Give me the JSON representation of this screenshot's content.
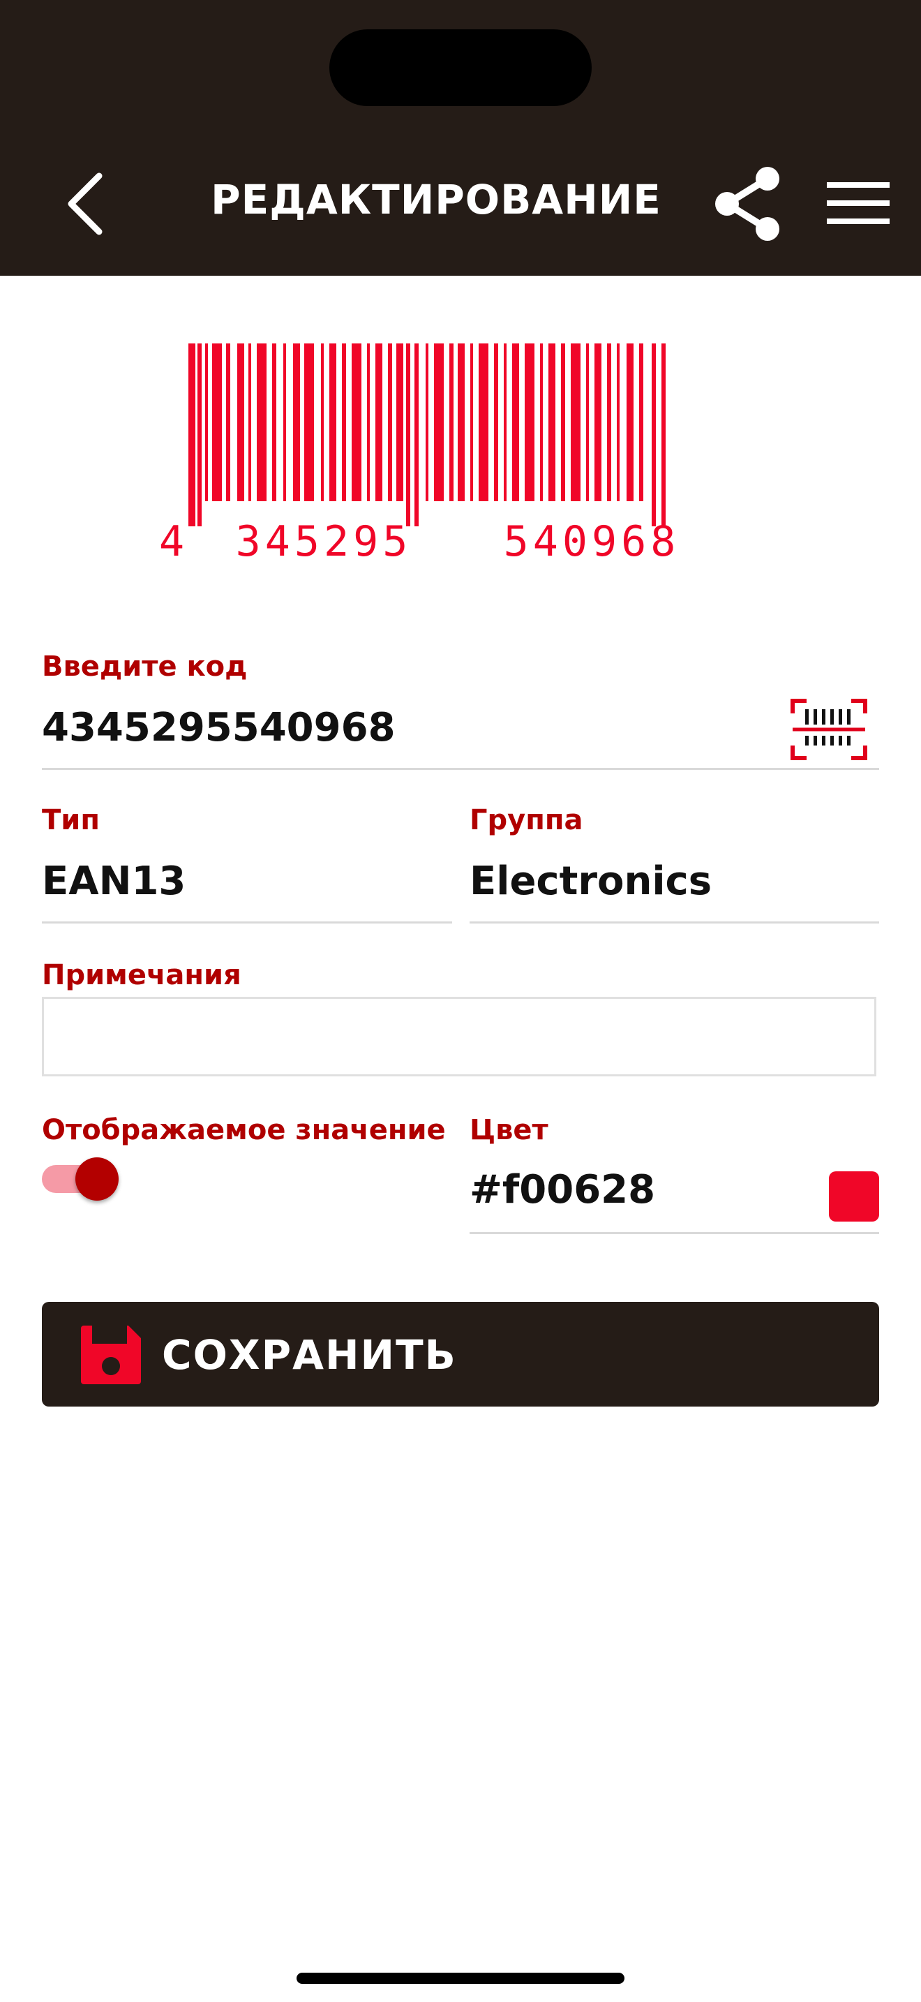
{
  "header": {
    "title": "РЕДАКТИРОВАНИЕ",
    "back_icon": "chevron-left-icon",
    "share_icon": "share-icon",
    "menu_icon": "hamburger-menu-icon"
  },
  "barcode": {
    "digits_left": "4",
    "digits_mid": "345295",
    "digits_right": "540968",
    "color": "#f00628"
  },
  "form": {
    "code_label": "Введите код",
    "code_value": "4345295540968",
    "scan_icon": "barcode-scan-icon",
    "type_label": "Тип",
    "type_value": "EAN13",
    "group_label": "Группа",
    "group_value": "Electronics",
    "notes_label": "Примечания",
    "notes_value": "",
    "display_label": "Отображаемое значение",
    "display_enabled": true,
    "color_label": "Цвет",
    "color_value": "#f00628",
    "accent": "#b00000"
  },
  "save_button": {
    "label": "СОХРАНИТЬ",
    "icon": "floppy-disk-icon"
  }
}
